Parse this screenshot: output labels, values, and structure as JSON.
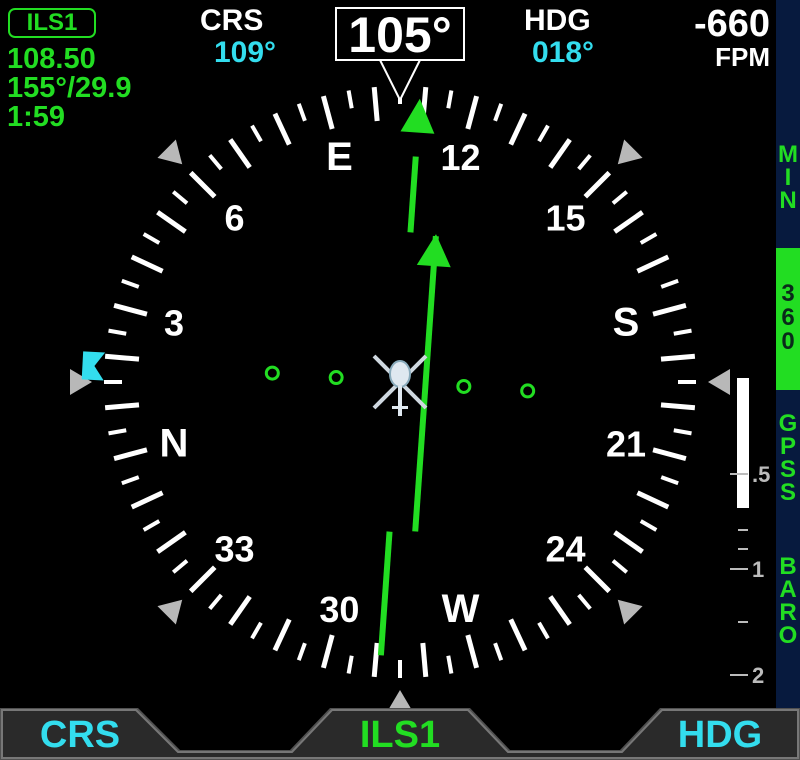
{
  "nav_source": {
    "label": "ILS1",
    "frequency": "108.50",
    "bearing_distance": "155°/29.9",
    "time": "1:59"
  },
  "course": {
    "label": "CRS",
    "value": "109°"
  },
  "heading_readout": {
    "value": "105°"
  },
  "heading_bug": {
    "label": "HDG",
    "value": "018°"
  },
  "vertical_speed": {
    "value": "-660",
    "unit": "FPM"
  },
  "compass": {
    "heading_deg": 105,
    "course_deg": 109,
    "heading_bug_deg": 18,
    "lateral_deviation_dots": 0.4,
    "cardinal_labels": [
      {
        "text": "N",
        "bearing": 0
      },
      {
        "text": "3",
        "bearing": 30
      },
      {
        "text": "6",
        "bearing": 60
      },
      {
        "text": "E",
        "bearing": 90
      },
      {
        "text": "12",
        "bearing": 120
      },
      {
        "text": "15",
        "bearing": 150
      },
      {
        "text": "S",
        "bearing": 180
      },
      {
        "text": "21",
        "bearing": 210
      },
      {
        "text": "24",
        "bearing": 240
      },
      {
        "text": "W",
        "bearing": 270
      },
      {
        "text": "30",
        "bearing": 300
      },
      {
        "text": "33",
        "bearing": 330
      }
    ]
  },
  "colors": {
    "nav_green": "#22dd22",
    "cyan": "#33ddee",
    "white": "#ffffff",
    "strip_blue": "#071a3e",
    "marker_gray": "#b8b8b8"
  },
  "icons": {
    "aircraft": "helicopter-icon",
    "course_pointer": "course-arrow-icon",
    "heading_bug": "heading-bug-icon"
  },
  "vertical_scale": {
    "labels": [
      ".5",
      "1",
      "2"
    ],
    "fill_fraction": 0.45
  },
  "right_strip": {
    "top_label": "MIN",
    "selected_value": "360",
    "items": [
      "GPSS",
      "BARO"
    ]
  },
  "softkeys": {
    "left": "CRS",
    "center": "ILS1",
    "right": "HDG"
  }
}
